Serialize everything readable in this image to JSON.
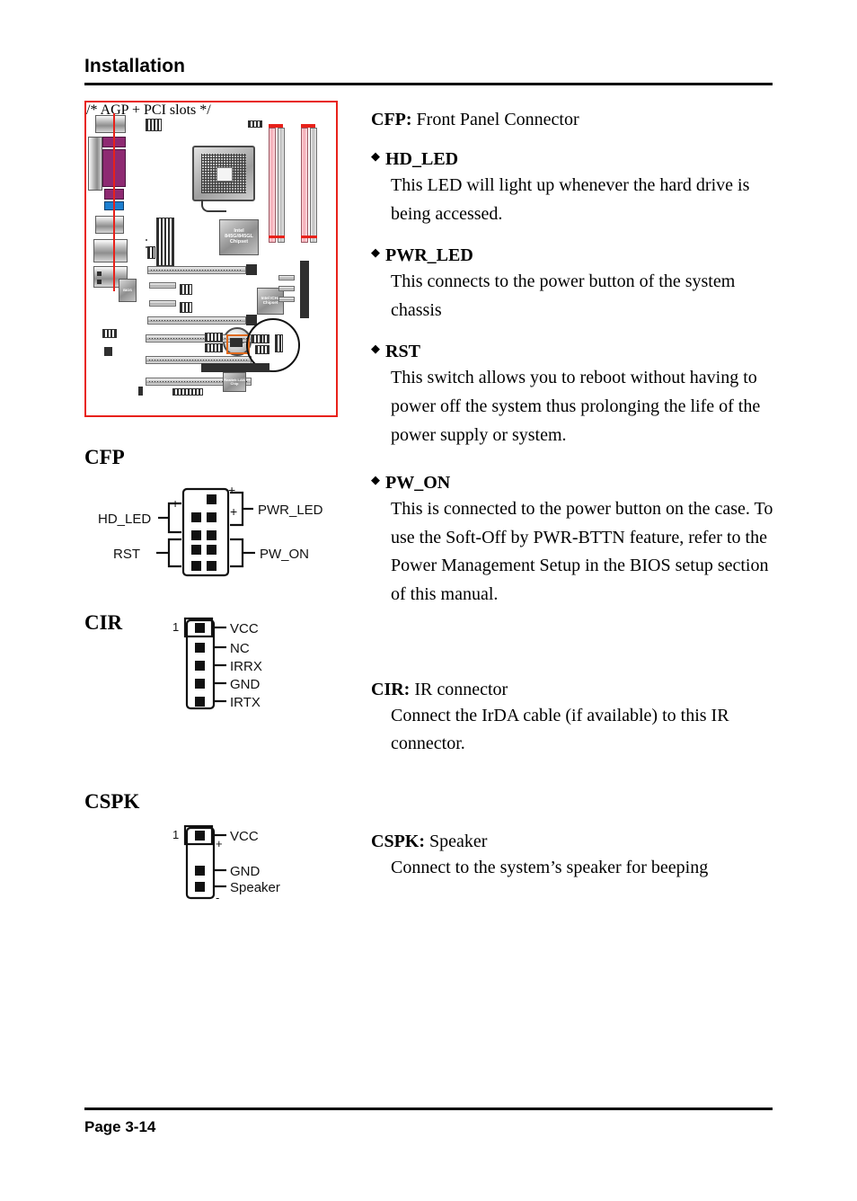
{
  "header": {
    "title": "Installation"
  },
  "footer": {
    "page_label": "Page 3-14"
  },
  "figure": {
    "board_labels": {
      "northbridge": "Intel 845G/845GL Chipset",
      "southbridge": "Intel ICH4 Chipset",
      "super_io": "Winbond Super I/O",
      "bios": "BIOS",
      "lan": "Realtek LAN Chip",
      "battery": "Battery"
    },
    "highlight_color": "#e06a1e",
    "border_color": "#e8211a"
  },
  "sections": {
    "cfp_label": "CFP",
    "cir_label": "CIR",
    "cspk_label": "CSPK"
  },
  "connectors": {
    "cfp": {
      "title": "CFP",
      "left_labels": [
        {
          "name": "HD_LED",
          "sign": "+"
        },
        {
          "name": "RST",
          "sign": ""
        }
      ],
      "right_labels": [
        {
          "name": "PWR_LED",
          "sign": "+"
        },
        {
          "name": "PW_ON",
          "sign": ""
        }
      ],
      "top_sign": "+",
      "rows": 5,
      "cols": 2
    },
    "cir": {
      "title": "CIR",
      "pin_one": "1",
      "pins": [
        "VCC",
        "NC",
        "IRRX",
        "GND",
        "IRTX"
      ]
    },
    "cspk": {
      "title": "CSPK",
      "pin_one": "1",
      "pins": [
        "VCC",
        "GND",
        "Speaker"
      ],
      "plus_sign": "+",
      "minus_sign": "-"
    }
  },
  "content": {
    "cfp": {
      "heading_term": "CFP:",
      "heading_rest": " Front Panel Connector",
      "items": [
        {
          "term": "HD_LED",
          "body": "This LED will light up whenever the hard drive is being accessed."
        },
        {
          "term": "PWR_LED",
          "body": "This connects to the power button of the system chassis"
        },
        {
          "term": "RST",
          "body": "This switch allows you to reboot without having to power off the system thus prolonging the life of the power supply or system."
        },
        {
          "term": "PW_ON",
          "body": "This is connected to the power button on the case.  To use the Soft-Off by PWR-BTTN feature, refer to the Power Management Setup in the BIOS setup section of this manual."
        }
      ],
      "bullet_glyph": "◆"
    },
    "cir": {
      "heading_term": "CIR:",
      "heading_rest": " IR connector",
      "body": "Connect the IrDA cable (if available) to this IR connector."
    },
    "cspk": {
      "heading_term": "CSPK:",
      "heading_rest": "  Speaker",
      "body": "Connect to the system’s speaker for beeping"
    }
  }
}
